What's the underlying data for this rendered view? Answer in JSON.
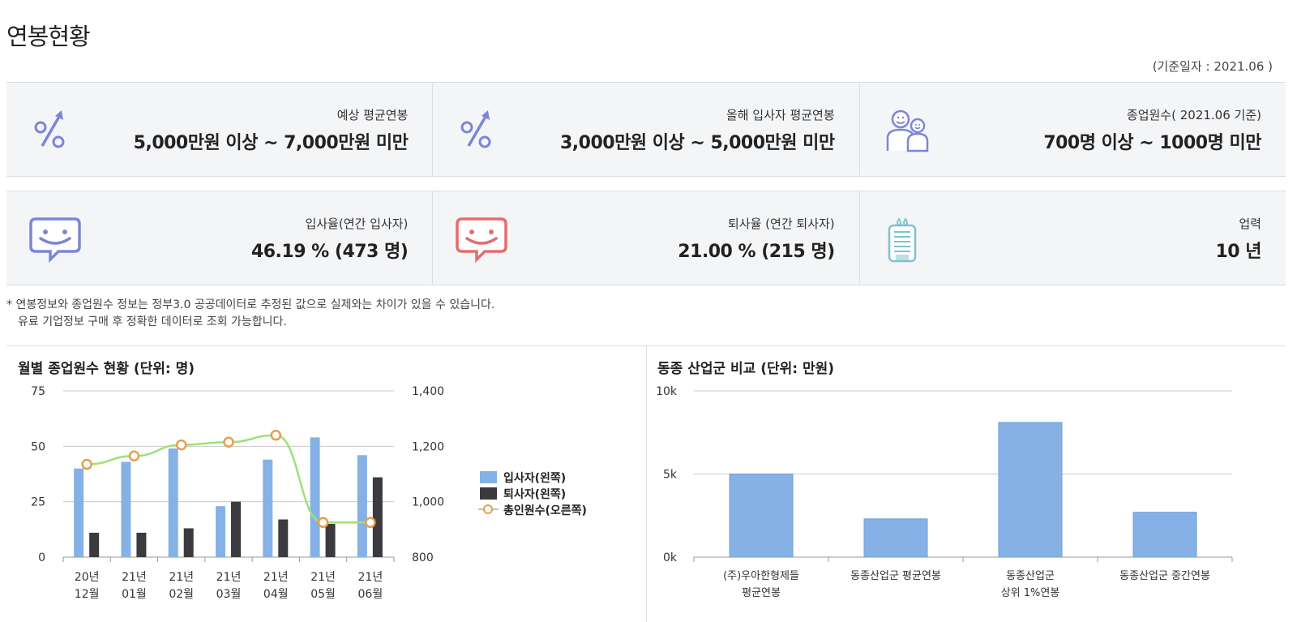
{
  "page": {
    "title": "연봉현황",
    "basis_date": "(기준일자 : 2021.06 )"
  },
  "stats": [
    {
      "label": "예상 평균연봉",
      "value": "5,000만원 이상 ~ 7,000만원 미만",
      "icon": "percent-up-icon"
    },
    {
      "label": "올해 입사자 평균연봉",
      "value": "3,000만원 이상 ~ 5,000만원 미만",
      "icon": "percent-up-icon"
    },
    {
      "label": "종업원수( 2021.06 기준)",
      "value": "700명 이상 ~ 1000명 미만",
      "icon": "people-icon"
    },
    {
      "label": "입사율(연간 입사자)",
      "value": "46.19 % (473 명)",
      "icon": "smile-bubble-blue-icon"
    },
    {
      "label": "퇴사율 (연간 퇴사자)",
      "value": "21.00 % (215 명)",
      "icon": "smile-bubble-red-icon"
    },
    {
      "label": "업력",
      "value": "10 년",
      "icon": "gift-calendar-icon"
    }
  ],
  "note": {
    "line1": "* 연봉정보와 종업원수 정보는 정부3.0 공공데이터로 추정된 값으로 실제와는 차이가 있을 수 있습니다.",
    "line2": "유료 기업정보 구매 후 정확한 데이터로 조회 가능합니다."
  },
  "colors": {
    "bar_blue": "#86b1e6",
    "bar_dark": "#3a3a3f",
    "line_green": "#9ee07a",
    "marker_orange": "#e6a04a",
    "panel_bg": "#f4f5f7",
    "icon_blue": "#7b86d9",
    "icon_red": "#e46d6d",
    "icon_teal": "#7cc4cf"
  },
  "chart_data": [
    {
      "type": "bar",
      "title": "월별 종업원수 현황 (단위: 명)",
      "categories": [
        [
          "20년",
          "12월"
        ],
        [
          "21년",
          "01월"
        ],
        [
          "21년",
          "02월"
        ],
        [
          "21년",
          "03월"
        ],
        [
          "21년",
          "04월"
        ],
        [
          "21년",
          "05월"
        ],
        [
          "21년",
          "06월"
        ]
      ],
      "left_axis": {
        "ylim": [
          0,
          75
        ],
        "ticks": [
          0,
          25,
          50,
          75
        ]
      },
      "right_axis": {
        "ylim": [
          800,
          1400
        ],
        "ticks": [
          800,
          1000,
          1200,
          1400
        ],
        "tick_labels": [
          "800",
          "1,000",
          "1,200",
          "1,400"
        ]
      },
      "series": [
        {
          "name": "입사자(왼쪽)",
          "type": "bar",
          "axis": "left",
          "values": [
            40,
            43,
            49,
            23,
            44,
            54,
            46
          ]
        },
        {
          "name": "퇴사자(왼쪽)",
          "type": "bar",
          "axis": "left",
          "values": [
            11,
            11,
            13,
            25,
            17,
            15,
            36
          ]
        },
        {
          "name": "총인원수(오른쪽)",
          "type": "line",
          "axis": "right",
          "values": [
            1135,
            1165,
            1205,
            1215,
            1240,
            925,
            925
          ]
        }
      ],
      "legend": "right",
      "grid": true
    },
    {
      "type": "bar",
      "title": "동종 산업군 비교 (단위: 만원)",
      "categories": [
        [
          "(주)우아한형제들",
          "평균연봉"
        ],
        [
          "동종산업군 평균연봉"
        ],
        [
          "동종산업군",
          "상위 1%연봉"
        ],
        [
          "동종산업군 중간연봉"
        ]
      ],
      "ylim": [
        0,
        10000
      ],
      "ticks": [
        0,
        5000,
        10000
      ],
      "tick_labels": [
        "0k",
        "5k",
        "10k"
      ],
      "values": [
        5000,
        2300,
        8100,
        2700
      ],
      "grid": true
    }
  ]
}
